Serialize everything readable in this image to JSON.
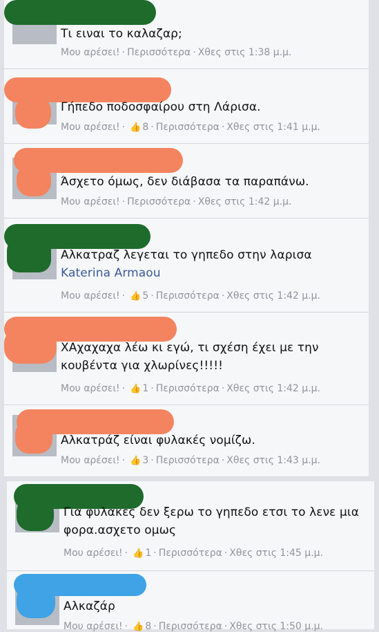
{
  "ui": {
    "like": "Μου αρέσει!",
    "more": "Περισσότερα",
    "separator": "·",
    "thumb_icon": "thumbs-up-icon"
  },
  "comments": [
    {
      "text": "Τι ειναι το καλαζαρ;",
      "likes": "",
      "time": "Χθες στις 1:38 μ.μ.",
      "redact_color": "#1e6b2c"
    },
    {
      "text": "Γήπεδο ποδοσφαίρου στη Λάρισα.",
      "likes": "8",
      "time": "Χθες στις 1:41 μ.μ.",
      "redact_color": "#f4845f"
    },
    {
      "text": "Άσχετο όμως, δεν διάβασα τα παραπάνω.",
      "likes": "",
      "time": "Χθες στις 1:42 μ.μ.",
      "redact_color": "#f4845f"
    },
    {
      "text": "Αλκατραζ λεγεται το γηπεδο στην λαρισα",
      "tag": "Katerina Armaou",
      "likes": "5",
      "time": "Χθες στις 1:42 μ.μ.",
      "redact_color": "#1e6b2c"
    },
    {
      "text": "ΧΑχαχαχα λέω κι εγώ, τι σχέση έχει με την κουβέντα για χλωρίνες!!!!!",
      "likes": "1",
      "time": "Χθες στις 1:42 μ.μ.",
      "redact_color": "#f4845f"
    },
    {
      "text": "Αλκατράζ είναι φυλακές νομίζω.",
      "likes": "3",
      "time": "Χθες στις 1:43 μ.μ.",
      "redact_color": "#f4845f"
    },
    {
      "text": "Για φυλακες δεν ξερω το γηπεδο ετσι το λενε μια φορα.ασχετο ομως",
      "likes": "1",
      "time": "Χθες στις 1:45 μ.μ.",
      "redact_color": "#1e6b2c"
    },
    {
      "text": "Αλκαζάρ",
      "likes": "8",
      "time": "Χθες στις 1:50 μ.μ.",
      "redact_color": "#3fa3e6"
    }
  ]
}
